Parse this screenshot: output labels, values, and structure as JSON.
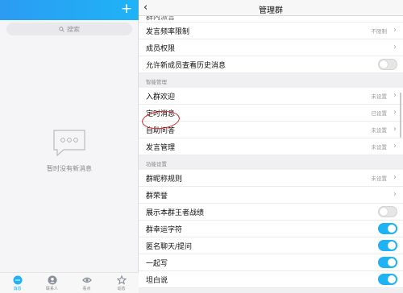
{
  "left": {
    "search_placeholder": "搜索",
    "empty_text": "暂时没有新消息",
    "nav": [
      {
        "label": "消息",
        "icon": "chat-icon"
      },
      {
        "label": "联系人",
        "icon": "contacts-icon"
      },
      {
        "label": "看点",
        "icon": "eye-icon"
      },
      {
        "label": "动态",
        "icon": "star-icon"
      }
    ]
  },
  "right": {
    "title": "管理群",
    "top_row": {
      "label": "群内派言"
    },
    "rows1": [
      {
        "label": "发言频率限制",
        "value": "不限制"
      },
      {
        "label": "成员权限",
        "value": ""
      }
    ],
    "history_row": {
      "label": "允许新成员查看历史消息"
    },
    "section_smart": "智能管理",
    "smart_rows": [
      {
        "label": "入群欢迎",
        "value": "未设置"
      },
      {
        "label": "定时消息",
        "value": "已设置"
      },
      {
        "label": "自助问答",
        "value": "未设置"
      },
      {
        "label": "发言管理",
        "value": "未设置"
      }
    ],
    "section_func": "功能设置",
    "func_rows": [
      {
        "label": "群昵称规则",
        "value": "未设置"
      },
      {
        "label": "群荣誉",
        "value": ""
      }
    ],
    "toggle_rows": [
      {
        "label": "展示本群王者战绩",
        "on": false
      },
      {
        "label": "群幸运字符",
        "on": true
      },
      {
        "label": "匿名聊天/提问",
        "on": true
      },
      {
        "label": "一起写",
        "on": true
      },
      {
        "label": "坦白说",
        "on": true
      }
    ]
  },
  "colors": {
    "accent": "#1fb2f4",
    "annotation": "#d8262a"
  }
}
